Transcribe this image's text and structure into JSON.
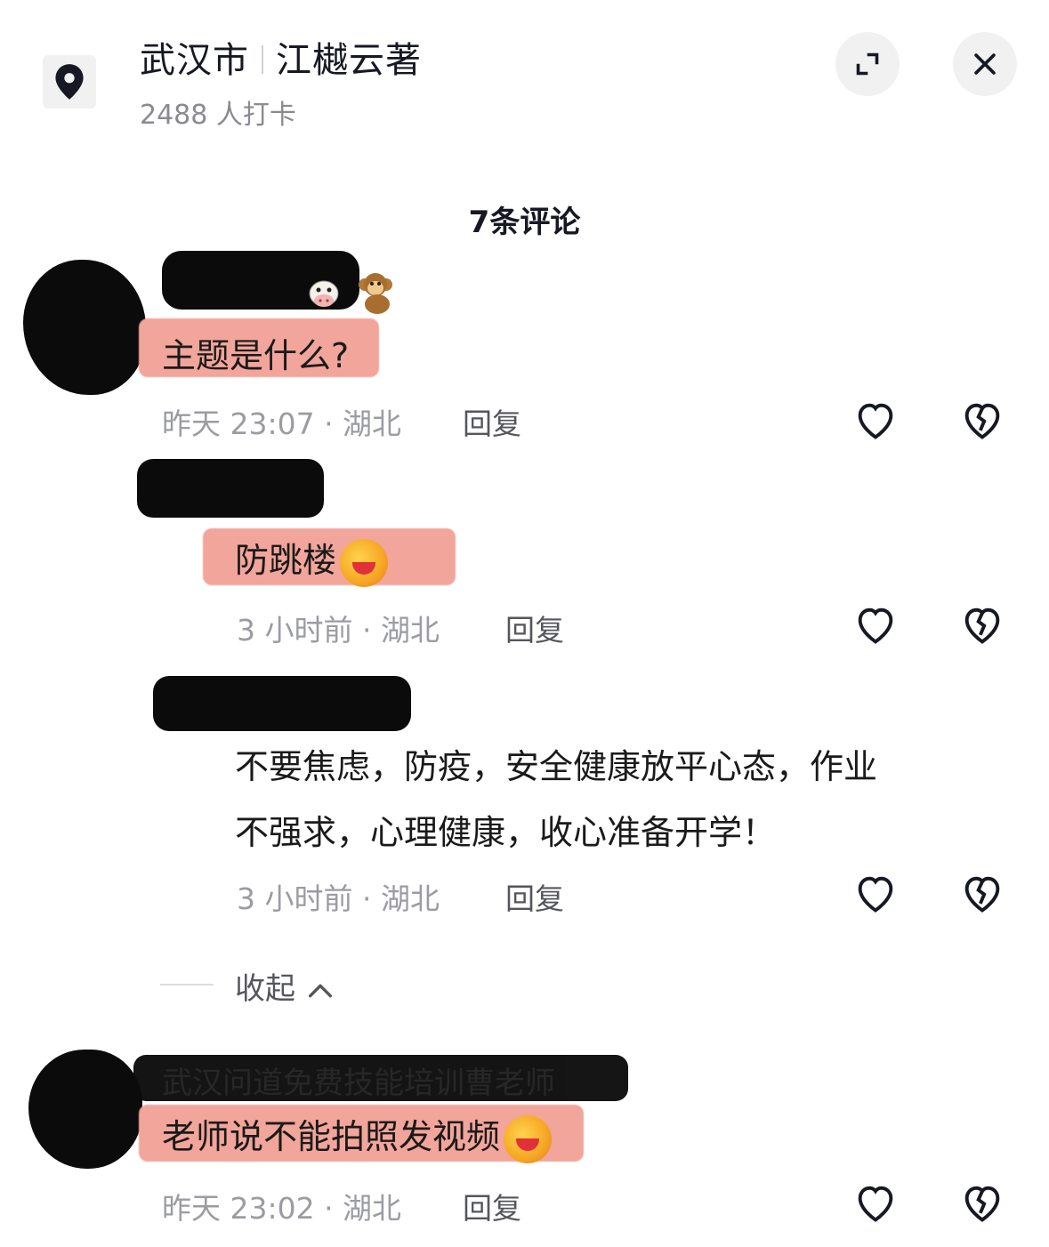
{
  "header": {
    "city": "武汉市",
    "place": "江樾云著",
    "checkins": "2488 人打卡"
  },
  "comments_count": "7条评论",
  "comments": [
    {
      "text": "主题是什么?",
      "time": "昨天 23:07 · 湖北",
      "reply": "回复"
    },
    {
      "text": "防跳楼",
      "time": "3 小时前 · 湖北",
      "reply": "回复"
    },
    {
      "text_line1": "不要焦虑，防疫，安全健康放平心态，作业",
      "text_line2": "不强求，心理健康，收心准备开学！",
      "time": "3 小时前 · 湖北",
      "reply": "回复"
    },
    {
      "text": "老师说不能拍照发视频",
      "time": "昨天 23:02 · 湖北",
      "reply": "回复",
      "username_obscured": "武汉问道免费技能培训曹老师"
    }
  ],
  "collapse_label": "收起",
  "icons": [
    "location-pin-icon",
    "expand-icon",
    "close-icon",
    "heart-icon",
    "broken-heart-icon",
    "cow-emoji",
    "monkey-emoji",
    "facepalm-laugh-emoji",
    "chevron-up-icon"
  ],
  "colors": {
    "highlight": "#f2a59a",
    "text": "#161823",
    "meta": "#9b9ca2"
  }
}
